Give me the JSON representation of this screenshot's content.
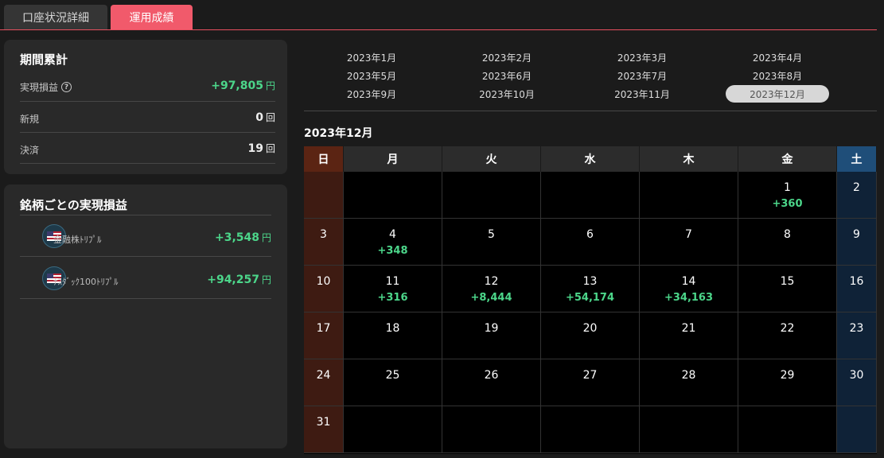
{
  "tabs": {
    "account_detail": "口座状況詳細",
    "performance": "運用成績"
  },
  "summary": {
    "title": "期間累計",
    "realized_label": "実現損益",
    "realized_value": "+97,805",
    "new_label": "新規",
    "new_value": "0",
    "settled_label": "決済",
    "settled_value": "19",
    "yen_unit": "円",
    "count_unit": "回"
  },
  "by_stock": {
    "title": "銘柄ごとの実現損益",
    "items": [
      {
        "name": "金融株ﾄﾘﾌﾟﾙ",
        "value": "+3,548",
        "unit": "円"
      },
      {
        "name": "ﾅｽﾀﾞｯｸ100ﾄﾘﾌﾟﾙ",
        "value": "+94,257",
        "unit": "円"
      }
    ]
  },
  "months": [
    "2023年1月",
    "2023年2月",
    "2023年3月",
    "2023年4月",
    "2023年5月",
    "2023年6月",
    "2023年7月",
    "2023年8月",
    "2023年9月",
    "2023年10月",
    "2023年11月",
    "2023年12月"
  ],
  "selected_month_index": 11,
  "calendar": {
    "title": "2023年12月",
    "weekdays": [
      "日",
      "月",
      "火",
      "水",
      "木",
      "金",
      "土"
    ],
    "first_weekday": 5,
    "days_in_month": 31,
    "values": {
      "1": "+360",
      "4": "+348",
      "11": "+316",
      "12": "+8,444",
      "13": "+54,174",
      "14": "+34,163"
    }
  },
  "colors": {
    "accent": "#f15a6b",
    "positive": "#4cd68a",
    "sunday": "#5b2413",
    "saturday": "#1f4e79"
  }
}
